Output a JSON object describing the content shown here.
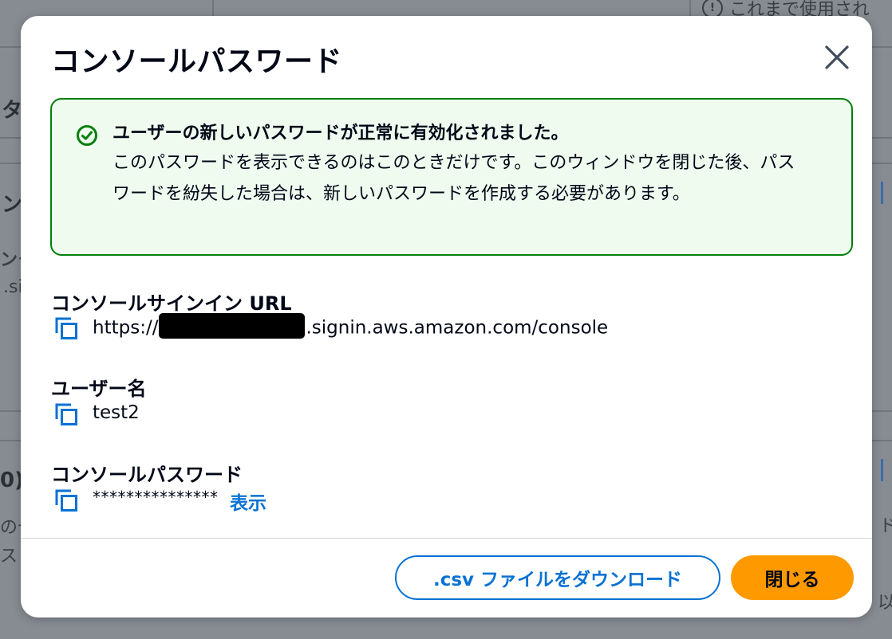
{
  "background": {
    "fragments": [
      "タ",
      "ン",
      "ンク",
      ".si",
      "0)",
      "のセ",
      "ス",
      "これまで使用され"
    ]
  },
  "modal": {
    "title": "コンソールパスワード",
    "close_label": "閉じる",
    "alert": {
      "title": "ユーザーの新しいパスワードが正常に有効化されました。",
      "body": "このパスワードを表示できるのはこのときだけです。このウィンドウを閉じた後、パスワードを紛失した場合は、新しいパスワードを作成する必要があります。"
    },
    "fields": {
      "signin_url": {
        "label": "コンソールサインイン URL",
        "prefix": "https://",
        "suffix": ".signin.aws.amazon.com/console"
      },
      "username": {
        "label": "ユーザー名",
        "value": "test2"
      },
      "password": {
        "label": "コンソールパスワード",
        "value": "***************",
        "show_label": "表示"
      }
    },
    "footer": {
      "download_label": ".csv ファイルをダウンロード",
      "close_label": "閉じる"
    }
  },
  "colors": {
    "success": "#037f0c",
    "success_bg": "#effbef",
    "link": "#0972d3",
    "primary": "#ff9900"
  }
}
